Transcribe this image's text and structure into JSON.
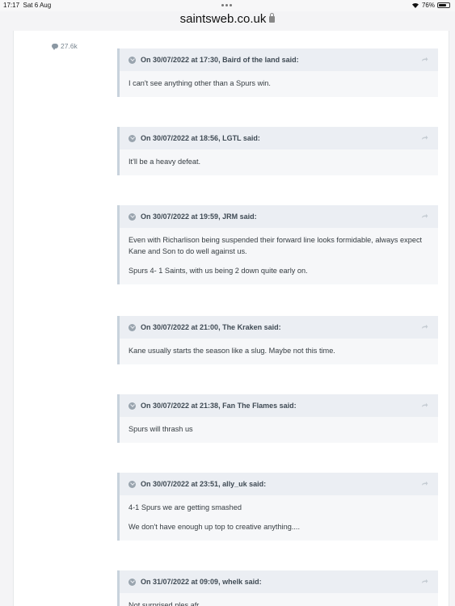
{
  "status": {
    "time": "17:17",
    "date": "Sat 6 Aug",
    "battery": "76%",
    "battery_level": 0.76
  },
  "browser": {
    "url": "saintsweb.co.uk"
  },
  "post": {
    "reputation": "27.6k"
  },
  "quotes": [
    {
      "citation": "On 30/07/2022 at 17:30, Baird of the land said:",
      "paragraphs": [
        "I can't see anything other than a Spurs win."
      ]
    },
    {
      "citation": "On 30/07/2022 at 18:56, LGTL said:",
      "paragraphs": [
        "It'll be a heavy defeat."
      ]
    },
    {
      "citation": "On 30/07/2022 at 19:59, JRM said:",
      "paragraphs": [
        "Even with Richarlison being suspended their forward line looks formidable, always expect Kane and Son to do well against us.",
        "Spurs 4- 1 Saints, with us being 2 down quite early on."
      ]
    },
    {
      "citation": "On 30/07/2022 at 21:00, The Kraken said:",
      "paragraphs": [
        "Kane usually starts the season like a slug. Maybe not this time."
      ]
    },
    {
      "citation": "On 30/07/2022 at 21:38, Fan The Flames said:",
      "paragraphs": [
        "Spurs will thrash us"
      ]
    },
    {
      "citation": "On 30/07/2022 at 23:51, ally_uk said:",
      "paragraphs": [
        "4-1 Spurs we are getting smashed",
        "We don't have enough up top to creative anything...."
      ]
    },
    {
      "citation": "On 31/07/2022 at 09:09, whelk said:",
      "paragraphs": [
        "Not surprised ples afr"
      ]
    }
  ]
}
